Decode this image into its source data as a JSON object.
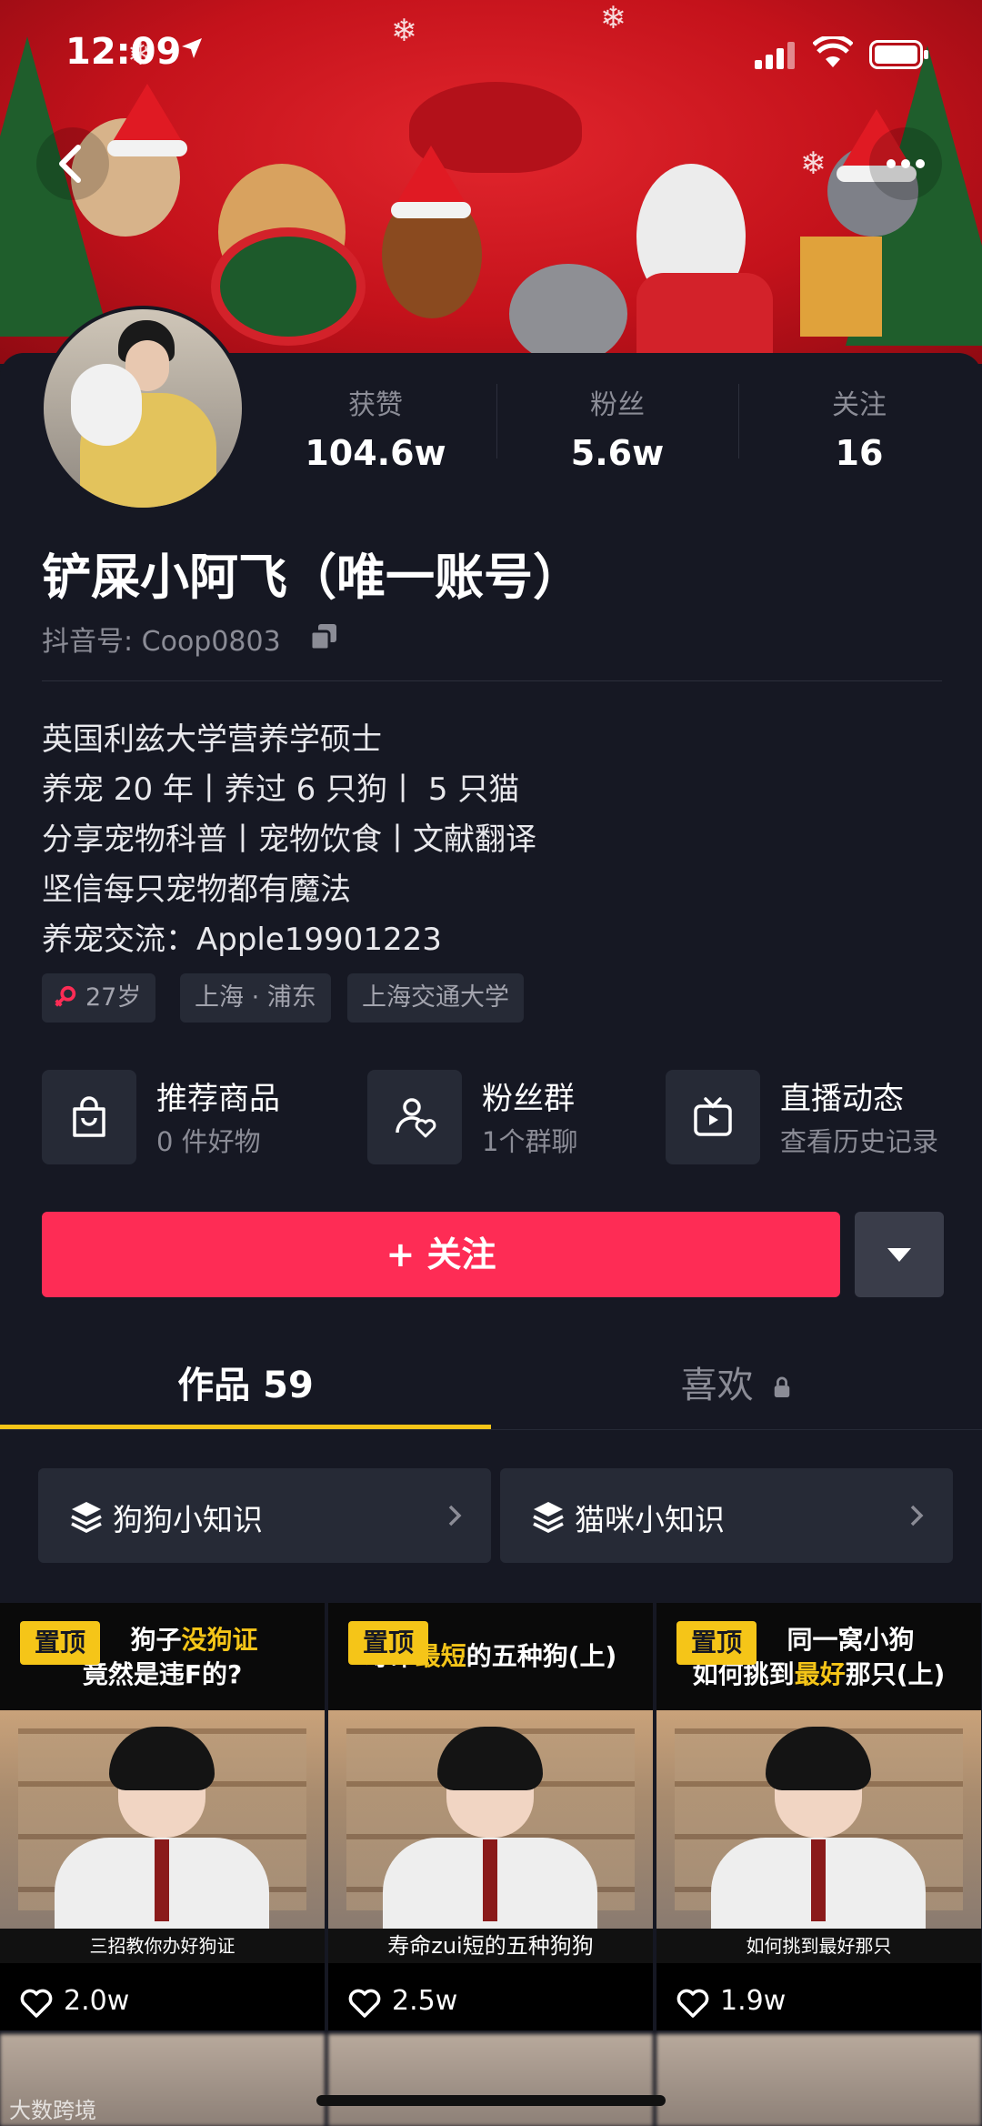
{
  "status": {
    "time": "12:09"
  },
  "profile": {
    "name": "铲屎小阿飞（唯一账号）",
    "account_id": "抖音号: Coop0803",
    "stats": [
      {
        "label": "获赞",
        "value": "104.6w"
      },
      {
        "label": "粉丝",
        "value": "5.6w"
      },
      {
        "label": "关注",
        "value": "16"
      }
    ],
    "bio": [
      "英国利兹大学营养学硕士",
      "养宠 20 年丨养过 6 只狗丨 5 只猫",
      "分享宠物科普丨宠物饮食丨文献翻译",
      "坚信每只宠物都有魔法",
      "养宠交流：Apple19901223"
    ],
    "tags": {
      "age": "27岁",
      "location": "上海 · 浦东",
      "school": "上海交通大学"
    }
  },
  "quick_cards": [
    {
      "title": "推荐商品",
      "subtitle": "0 件好物",
      "icon": "shopping-bag-icon"
    },
    {
      "title": "粉丝群",
      "subtitle": "1个群聊",
      "icon": "group-icon"
    },
    {
      "title": "直播动态",
      "subtitle": "查看历史记录",
      "icon": "tv-icon"
    }
  ],
  "follow_button": "+ 关注",
  "tabs": [
    {
      "label": "作品 59",
      "active": true
    },
    {
      "label": "喜欢",
      "locked": true
    }
  ],
  "collections": [
    {
      "label": "狗狗小知识"
    },
    {
      "label": "猫咪小知识"
    }
  ],
  "videos": [
    {
      "pinned": "置顶",
      "title_pre": "狗子",
      "title_hl": "没狗证",
      "title_line2": "竟然是违F的?",
      "subtitle": "三招教你办好狗证",
      "likes": "2.0w"
    },
    {
      "pinned": "置顶",
      "title_pre": "寿命",
      "title_hl": "最短",
      "title_post": "的五种狗(上)",
      "subtitle": "寿命zui短的五种狗狗",
      "likes": "2.5w"
    },
    {
      "pinned": "置顶",
      "title_line1": "同一窝小狗",
      "title_pre": "如何挑到",
      "title_hl": "最好",
      "title_post": "那只(上)",
      "subtitle": "如何挑到最好那只",
      "likes": "1.9w"
    }
  ],
  "watermark": "大数跨境",
  "colors": {
    "accent": "#fe2c55",
    "background": "#161823",
    "highlight": "#f5c518"
  }
}
